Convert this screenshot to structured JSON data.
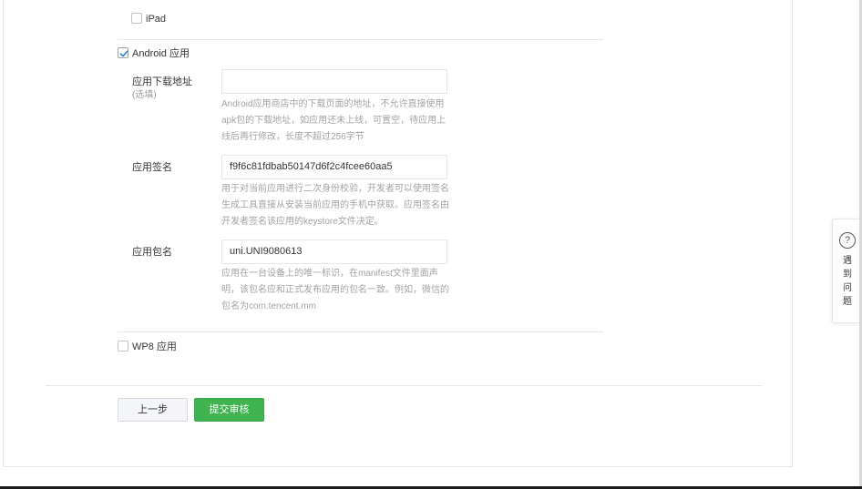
{
  "platforms": {
    "ipad": {
      "label": "iPad",
      "checked": false
    },
    "android": {
      "label": "Android 应用",
      "checked": true
    },
    "wp8": {
      "label": "WP8 应用",
      "checked": false
    }
  },
  "android_form": {
    "download_url": {
      "label": "应用下载地址",
      "sublabel": "(选填)",
      "value": "",
      "hint": "Android应用商店中的下载页面的地址，不允许直接使用apk包的下载地址，如应用还未上线，可置空，待应用上线后再行修改，长度不超过256字节"
    },
    "signature": {
      "label": "应用签名",
      "value": "f9f6c81fdbab50147d6f2c4fcee60aa5",
      "hint": "用于对当前应用进行二次身份校验，开发者可以使用签名生成工具直接从安装当前应用的手机中获取。应用签名由开发者签名该应用的keystore文件决定。"
    },
    "package_name": {
      "label": "应用包名",
      "value": "uni.UNI9080613",
      "hint": "应用在一台设备上的唯一标识，在manifest文件里面声明，该包名应和正式发布应用的包名一致。例如，微信的包名为com.tencent.mm"
    }
  },
  "actions": {
    "prev_label": "上一步",
    "submit_label": "提交审核"
  },
  "help_float": {
    "icon_glyph": "?",
    "text": "遇到问题"
  },
  "colors": {
    "primary_green": "#3fb34f",
    "hint_gray": "#a3a3a3"
  }
}
